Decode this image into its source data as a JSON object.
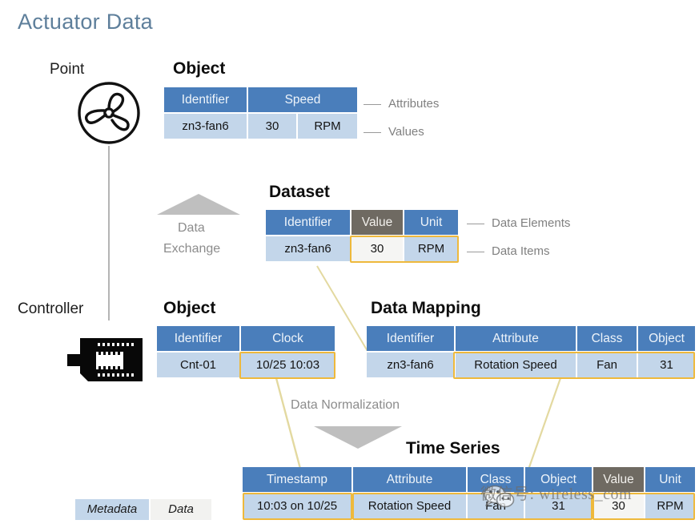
{
  "page": {
    "title": "Actuator Data"
  },
  "nodes": {
    "point_label": "Point",
    "controller_label": "Controller",
    "point_icon": "fan-icon",
    "controller_icon": "controller-chip-icon"
  },
  "blocks": {
    "object_top": {
      "title": "Object",
      "headers": [
        "Identifier",
        "Speed"
      ],
      "values": [
        "zn3-fan6",
        "30",
        "RPM"
      ]
    },
    "dataset": {
      "title": "Dataset",
      "headers": [
        "Identifier",
        "Value",
        "Unit"
      ],
      "values": [
        "zn3-fan6",
        "30",
        "RPM"
      ]
    },
    "object_bottom": {
      "title": "Object",
      "headers": [
        "Identifier",
        "Clock"
      ],
      "values": [
        "Cnt-01",
        "10/25 10:03"
      ]
    },
    "data_mapping": {
      "title": "Data Mapping",
      "headers": [
        "Identifier",
        "Attribute",
        "Class",
        "Object"
      ],
      "values": [
        "zn3-fan6",
        "Rotation Speed",
        "Fan",
        "31"
      ]
    },
    "time_series": {
      "title": "Time Series",
      "headers": [
        "Timestamp",
        "Attribute",
        "Class",
        "Object",
        "Value",
        "Unit"
      ],
      "values": [
        "10:03 on 10/25",
        "Rotation Speed",
        "Fan",
        "31",
        "30",
        "RPM"
      ]
    }
  },
  "callouts": {
    "attributes": "Attributes",
    "values": "Values",
    "data_elements": "Data Elements",
    "data_items": "Data Items"
  },
  "arrows": {
    "data_exchange_line1": "Data",
    "data_exchange_line2": "Exchange",
    "data_normalization": "Data  Normalization"
  },
  "legend": {
    "metadata": "Metadata",
    "data": "Data"
  },
  "watermark": {
    "text": "微信号: wireless_com",
    "icon": "wechat-icon"
  },
  "colors": {
    "title": "#5e7f9b",
    "header_blue": "#4a7ebb",
    "row_blue": "#c3d6ea",
    "header_grey": "#6f6a62",
    "row_white": "#f5f5f3",
    "highlight": "#eeb93c",
    "connector": "#e3d9a0",
    "arrow_grey": "#b8b8b8"
  }
}
